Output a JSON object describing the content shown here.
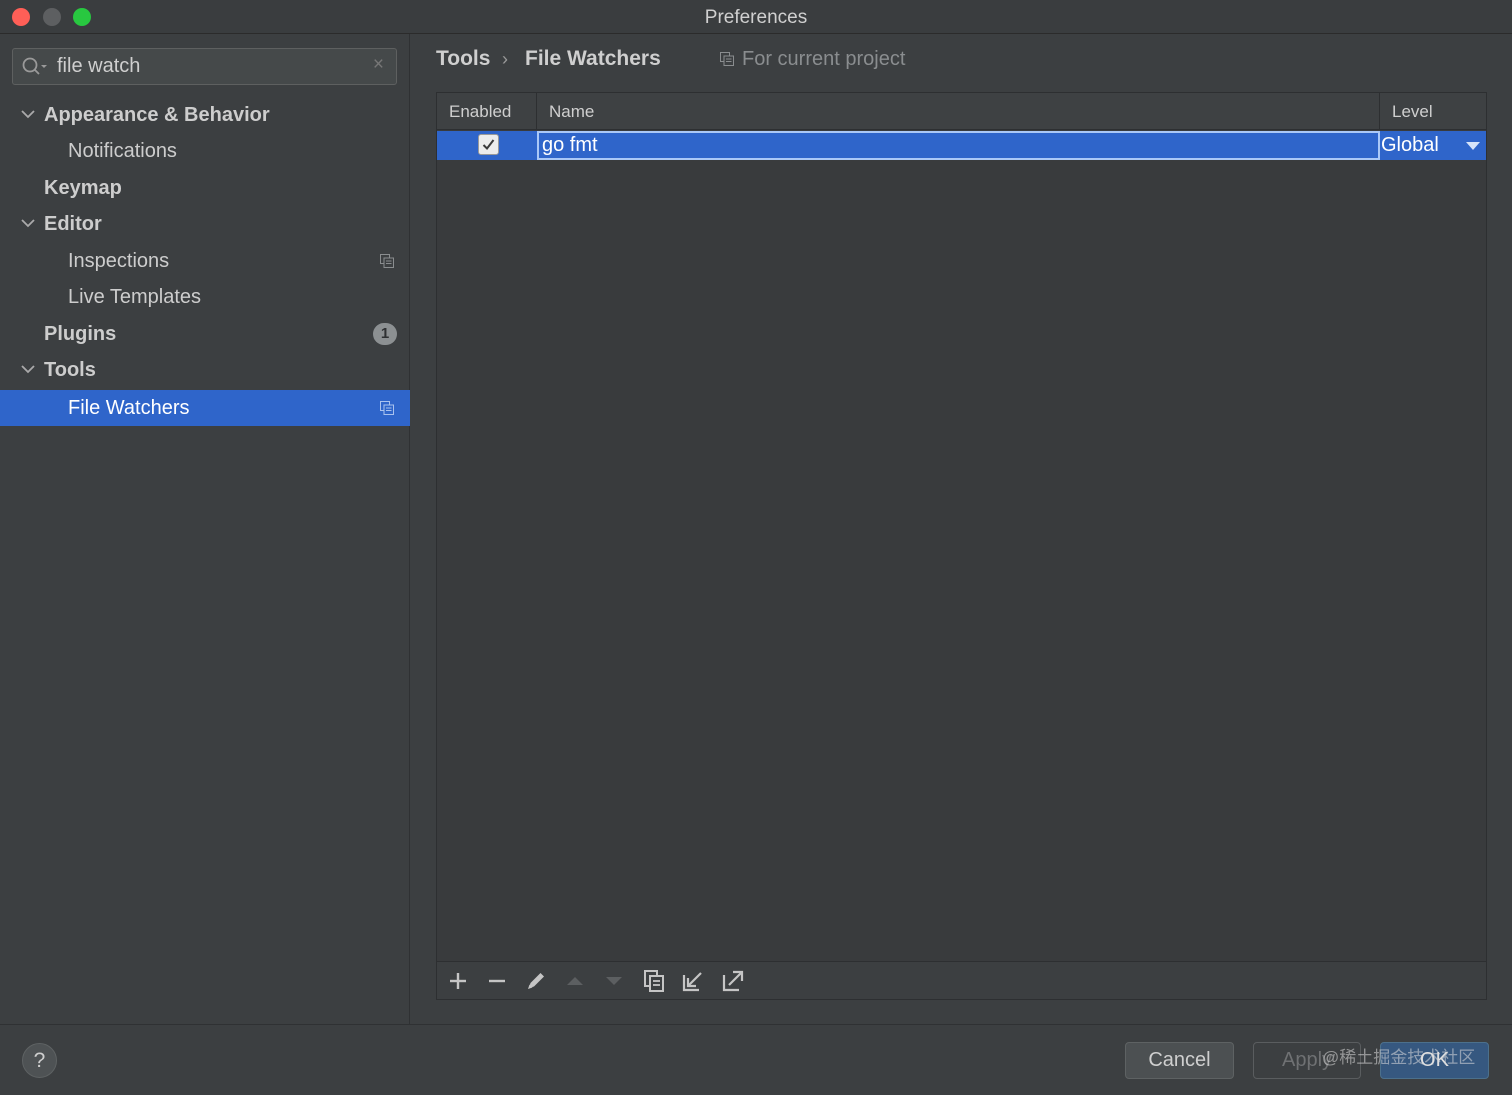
{
  "window": {
    "title": "Preferences"
  },
  "colors": {
    "accent": "#2f65ca",
    "background": "#3c3f41",
    "close": "#ff5f57",
    "maximize": "#28c840"
  },
  "search": {
    "value": "file watch"
  },
  "sidebar": {
    "items": [
      {
        "label": "Appearance & Behavior",
        "expanded": true
      },
      {
        "label": "Notifications"
      },
      {
        "label": "Keymap"
      },
      {
        "label": "Editor",
        "expanded": true
      },
      {
        "label": "Inspections",
        "icon": "project-scope-icon"
      },
      {
        "label": "Live Templates"
      },
      {
        "label": "Plugins",
        "badge": "1"
      },
      {
        "label": "Tools",
        "expanded": true
      },
      {
        "label": "File Watchers",
        "selected": true,
        "icon": "project-scope-icon"
      }
    ]
  },
  "breadcrumb": {
    "parent": "Tools",
    "separator": "›",
    "current": "File Watchers",
    "scope": "For current project"
  },
  "table": {
    "columns": [
      "Enabled",
      "Name",
      "Level"
    ],
    "rows": [
      {
        "enabled": true,
        "name": "go fmt",
        "level": "Global"
      }
    ]
  },
  "toolbar": {
    "buttons": [
      "add-icon",
      "remove-icon",
      "edit-icon",
      "move-up-icon",
      "move-down-icon",
      "copy-icon",
      "import-icon",
      "export-icon"
    ]
  },
  "footer": {
    "help": "?",
    "cancel": "Cancel",
    "apply": "Apply",
    "ok": "OK"
  },
  "watermark": "@稀土掘金技术社区"
}
